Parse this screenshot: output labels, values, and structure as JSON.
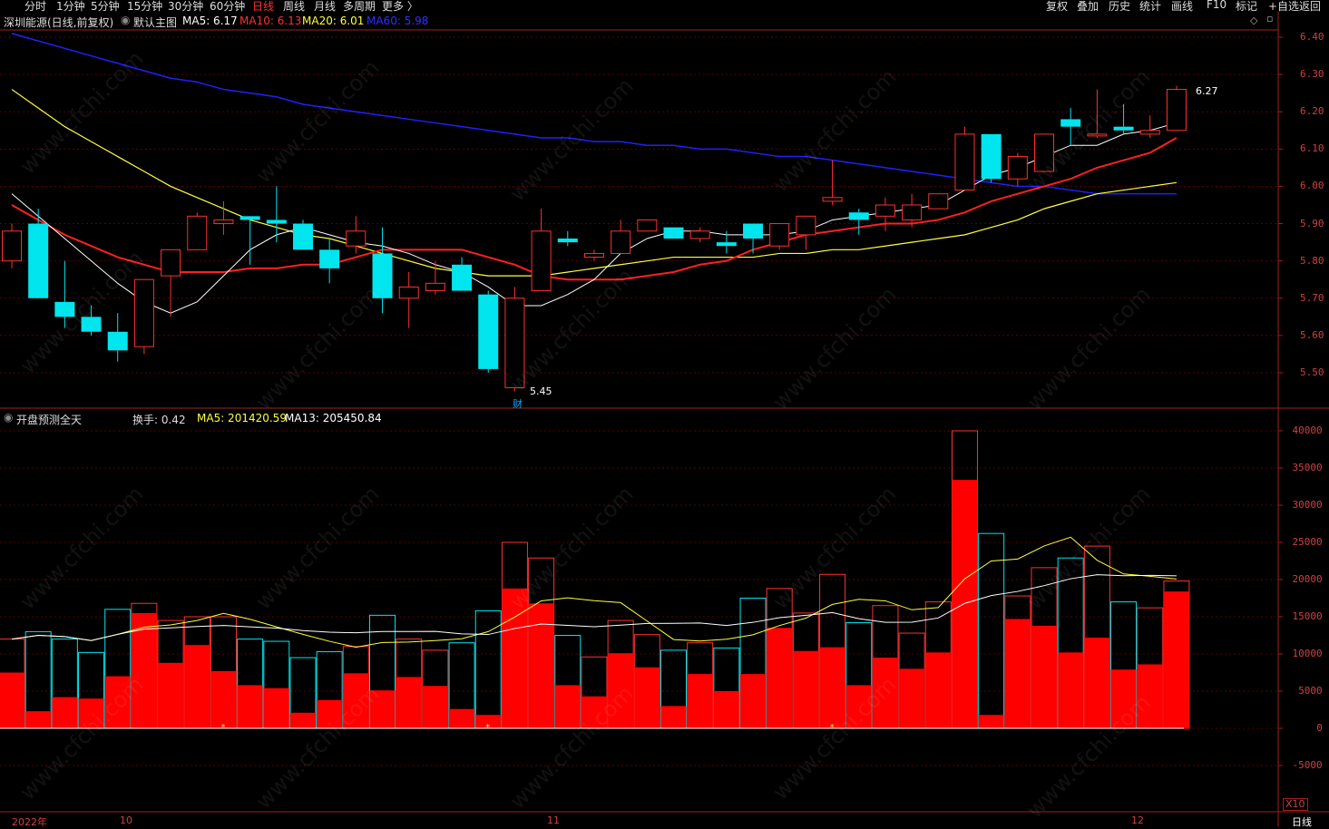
{
  "period_tabs": [
    "分时",
    "1分钟",
    "5分钟",
    "15分钟",
    "30分钟",
    "60分钟",
    "日线",
    "周线",
    "月线",
    "多周期",
    "更多 〉"
  ],
  "active_tab": "日线",
  "right_tabs": [
    "复权",
    "叠加",
    "历史",
    "统计",
    "画线",
    "F10",
    "标记",
    "+自选",
    "返回"
  ],
  "main": {
    "title": "深圳能源(日线,前复权)",
    "indicator": "默认主图",
    "ma5": "MA5: 6.17",
    "ma10": "MA10: 6.13",
    "ma20": "MA20: 6.01",
    "ma60": "MA60: 5.98",
    "high_label": "6.27",
    "low_label": "5.45",
    "fin_badge": "财",
    "y_ticks": [
      "6.40",
      "6.30",
      "6.20",
      "6.10",
      "6.00",
      "5.90",
      "5.80",
      "5.70",
      "5.60",
      "5.50"
    ]
  },
  "volume": {
    "title": "开盘预测全天",
    "turnover": "换手: 0.42",
    "ma5": "MA5: 201420.59",
    "ma13": "MA13: 205450.84",
    "y_ticks": [
      "40000",
      "35000",
      "30000",
      "25000",
      "20000",
      "15000",
      "10000",
      "5000",
      "0",
      "-5000"
    ],
    "unit": "X10"
  },
  "x_labels": {
    "year": "2022年",
    "m10": "10",
    "m11": "11",
    "m12": "12"
  },
  "bottom_period": "日线",
  "watermark": "www.cfchi.com",
  "colors": {
    "up": "#ff3030",
    "down": "#00e5ee",
    "ma5": "#ffffff",
    "ma10": "#ff2020",
    "ma20": "#ffff40",
    "ma60": "#2020ff",
    "grid": "#5a0000"
  },
  "chart_data": {
    "type": "candlestick",
    "price_ylim": [
      5.45,
      6.45
    ],
    "volume_ylim": [
      -5000,
      40000
    ],
    "candles": [
      {
        "o": 5.8,
        "c": 5.88,
        "h": 5.9,
        "l": 5.78,
        "v": 7500,
        "vf": 12000
      },
      {
        "o": 5.9,
        "c": 5.7,
        "h": 5.94,
        "l": 5.7,
        "v": 2300,
        "vf": 13000
      },
      {
        "o": 5.69,
        "c": 5.65,
        "h": 5.8,
        "l": 5.62,
        "v": 4200,
        "vf": 12000
      },
      {
        "o": 5.65,
        "c": 5.61,
        "h": 5.68,
        "l": 5.6,
        "v": 4000,
        "vf": 10200
      },
      {
        "o": 5.61,
        "c": 5.56,
        "h": 5.66,
        "l": 5.53,
        "v": 7000,
        "vf": 16000
      },
      {
        "o": 5.57,
        "c": 5.75,
        "h": 5.75,
        "l": 5.55,
        "v": 15500,
        "vf": 16800
      },
      {
        "o": 5.76,
        "c": 5.83,
        "h": 5.83,
        "l": 5.65,
        "v": 8800,
        "vf": 14500
      },
      {
        "o": 5.83,
        "c": 5.92,
        "h": 5.93,
        "l": 5.83,
        "v": 11200,
        "vf": 15000
      },
      {
        "o": 5.9,
        "c": 5.91,
        "h": 5.96,
        "l": 5.87,
        "v": 7700,
        "vf": 15000
      },
      {
        "o": 5.92,
        "c": 5.91,
        "h": 5.92,
        "l": 5.79,
        "v": 5800,
        "vf": 12000
      },
      {
        "o": 5.91,
        "c": 5.9,
        "h": 6.0,
        "l": 5.85,
        "v": 5400,
        "vf": 11700
      },
      {
        "o": 5.9,
        "c": 5.83,
        "h": 5.91,
        "l": 5.83,
        "v": 2100,
        "vf": 9500
      },
      {
        "o": 5.83,
        "c": 5.78,
        "h": 5.86,
        "l": 5.74,
        "v": 3800,
        "vf": 10300
      },
      {
        "o": 5.84,
        "c": 5.88,
        "h": 5.92,
        "l": 5.82,
        "v": 7400,
        "vf": 11000
      },
      {
        "o": 5.82,
        "c": 5.7,
        "h": 5.89,
        "l": 5.66,
        "v": 5100,
        "vf": 15200
      },
      {
        "o": 5.7,
        "c": 5.73,
        "h": 5.77,
        "l": 5.62,
        "v": 6900,
        "vf": 12000
      },
      {
        "o": 5.72,
        "c": 5.74,
        "h": 5.8,
        "l": 5.71,
        "v": 5700,
        "vf": 10500
      },
      {
        "o": 5.79,
        "c": 5.72,
        "h": 5.81,
        "l": 5.72,
        "v": 2600,
        "vf": 11500
      },
      {
        "o": 5.71,
        "c": 5.51,
        "h": 5.72,
        "l": 5.5,
        "v": 1800,
        "vf": 15800
      },
      {
        "o": 5.46,
        "c": 5.7,
        "h": 5.73,
        "l": 5.45,
        "v": 18800,
        "vf": 25000
      },
      {
        "o": 5.72,
        "c": 5.88,
        "h": 5.94,
        "l": 5.72,
        "v": 16800,
        "vf": 22900
      },
      {
        "o": 5.86,
        "c": 5.85,
        "h": 5.88,
        "l": 5.84,
        "v": 5800,
        "vf": 12500
      },
      {
        "o": 5.81,
        "c": 5.82,
        "h": 5.83,
        "l": 5.8,
        "v": 4300,
        "vf": 9600
      },
      {
        "o": 5.82,
        "c": 5.88,
        "h": 5.91,
        "l": 5.82,
        "v": 10100,
        "vf": 14500
      },
      {
        "o": 5.88,
        "c": 5.91,
        "h": 5.91,
        "l": 5.88,
        "v": 8200,
        "vf": 12600
      },
      {
        "o": 5.89,
        "c": 5.86,
        "h": 5.89,
        "l": 5.86,
        "v": 3000,
        "vf": 10500
      },
      {
        "o": 5.86,
        "c": 5.88,
        "h": 5.89,
        "l": 5.85,
        "v": 7300,
        "vf": 11500
      },
      {
        "o": 5.85,
        "c": 5.84,
        "h": 5.88,
        "l": 5.82,
        "v": 5000,
        "vf": 10800
      },
      {
        "o": 5.9,
        "c": 5.86,
        "h": 5.9,
        "l": 5.82,
        "v": 7300,
        "vf": 17500
      },
      {
        "o": 5.84,
        "c": 5.9,
        "h": 5.9,
        "l": 5.83,
        "v": 13500,
        "vf": 18800
      },
      {
        "o": 5.87,
        "c": 5.92,
        "h": 5.92,
        "l": 5.83,
        "v": 10400,
        "vf": 15500
      },
      {
        "o": 5.96,
        "c": 5.97,
        "h": 6.07,
        "l": 5.95,
        "v": 10900,
        "vf": 20700
      },
      {
        "o": 5.93,
        "c": 5.91,
        "h": 5.94,
        "l": 5.87,
        "v": 5800,
        "vf": 14200
      },
      {
        "o": 5.92,
        "c": 5.95,
        "h": 5.97,
        "l": 5.88,
        "v": 9500,
        "vf": 16500
      },
      {
        "o": 5.91,
        "c": 5.95,
        "h": 5.98,
        "l": 5.89,
        "v": 8000,
        "vf": 12800
      },
      {
        "o": 5.94,
        "c": 5.98,
        "h": 5.98,
        "l": 5.94,
        "v": 10200,
        "vf": 17000
      },
      {
        "o": 5.99,
        "c": 6.14,
        "h": 6.16,
        "l": 5.99,
        "v": 33400,
        "vf": 40000
      },
      {
        "o": 6.14,
        "c": 6.02,
        "h": 6.14,
        "l": 6.01,
        "v": 1800,
        "vf": 26200
      },
      {
        "o": 6.02,
        "c": 6.08,
        "h": 6.09,
        "l": 6.0,
        "v": 14700,
        "vf": 17800
      },
      {
        "o": 6.04,
        "c": 6.14,
        "h": 6.14,
        "l": 6.04,
        "v": 13800,
        "vf": 21600
      },
      {
        "o": 6.18,
        "c": 6.16,
        "h": 6.21,
        "l": 6.11,
        "v": 10200,
        "vf": 22900
      },
      {
        "o": 6.14,
        "c": 6.14,
        "h": 6.26,
        "l": 6.13,
        "v": 12200,
        "vf": 24500
      },
      {
        "o": 6.16,
        "c": 6.15,
        "h": 6.22,
        "l": 6.14,
        "v": 7900,
        "vf": 17000
      },
      {
        "o": 6.14,
        "c": 6.15,
        "h": 6.19,
        "l": 6.13,
        "v": 8600,
        "vf": 16200
      },
      {
        "o": 6.15,
        "c": 6.26,
        "h": 6.27,
        "l": 6.15,
        "v": 18400,
        "vf": 19800
      }
    ],
    "ma5": [
      5.98,
      5.92,
      5.86,
      5.8,
      5.74,
      5.69,
      5.66,
      5.69,
      5.76,
      5.83,
      5.87,
      5.89,
      5.87,
      5.85,
      5.84,
      5.82,
      5.79,
      5.77,
      5.73,
      5.68,
      5.68,
      5.71,
      5.75,
      5.82,
      5.86,
      5.88,
      5.88,
      5.87,
      5.87,
      5.87,
      5.88,
      5.91,
      5.92,
      5.93,
      5.94,
      5.95,
      5.99,
      6.03,
      6.05,
      6.08,
      6.11,
      6.11,
      6.14,
      6.15,
      6.17
    ],
    "ma10": [
      5.95,
      5.91,
      5.87,
      5.84,
      5.81,
      5.79,
      5.77,
      5.77,
      5.77,
      5.78,
      5.78,
      5.79,
      5.79,
      5.81,
      5.83,
      5.83,
      5.83,
      5.83,
      5.81,
      5.79,
      5.76,
      5.75,
      5.75,
      5.75,
      5.76,
      5.77,
      5.79,
      5.8,
      5.83,
      5.85,
      5.87,
      5.88,
      5.89,
      5.9,
      5.9,
      5.91,
      5.93,
      5.96,
      5.98,
      6.0,
      6.02,
      6.05,
      6.07,
      6.09,
      6.13
    ],
    "ma20": [
      6.26,
      6.21,
      6.16,
      6.12,
      6.08,
      6.04,
      6.0,
      5.97,
      5.94,
      5.91,
      5.89,
      5.87,
      5.86,
      5.84,
      5.82,
      5.8,
      5.78,
      5.77,
      5.76,
      5.76,
      5.76,
      5.77,
      5.78,
      5.79,
      5.8,
      5.81,
      5.81,
      5.81,
      5.81,
      5.82,
      5.82,
      5.83,
      5.83,
      5.84,
      5.85,
      5.86,
      5.87,
      5.89,
      5.91,
      5.94,
      5.96,
      5.98,
      5.99,
      6.0,
      6.01
    ],
    "ma60": [
      6.41,
      6.39,
      6.37,
      6.35,
      6.33,
      6.31,
      6.29,
      6.28,
      6.26,
      6.25,
      6.24,
      6.22,
      6.21,
      6.2,
      6.19,
      6.18,
      6.17,
      6.16,
      6.15,
      6.14,
      6.13,
      6.13,
      6.12,
      6.12,
      6.11,
      6.11,
      6.1,
      6.1,
      6.09,
      6.08,
      6.08,
      6.07,
      6.06,
      6.05,
      6.04,
      6.03,
      6.02,
      6.01,
      6.0,
      6.0,
      5.99,
      5.98,
      5.98,
      5.98,
      5.98
    ]
  }
}
